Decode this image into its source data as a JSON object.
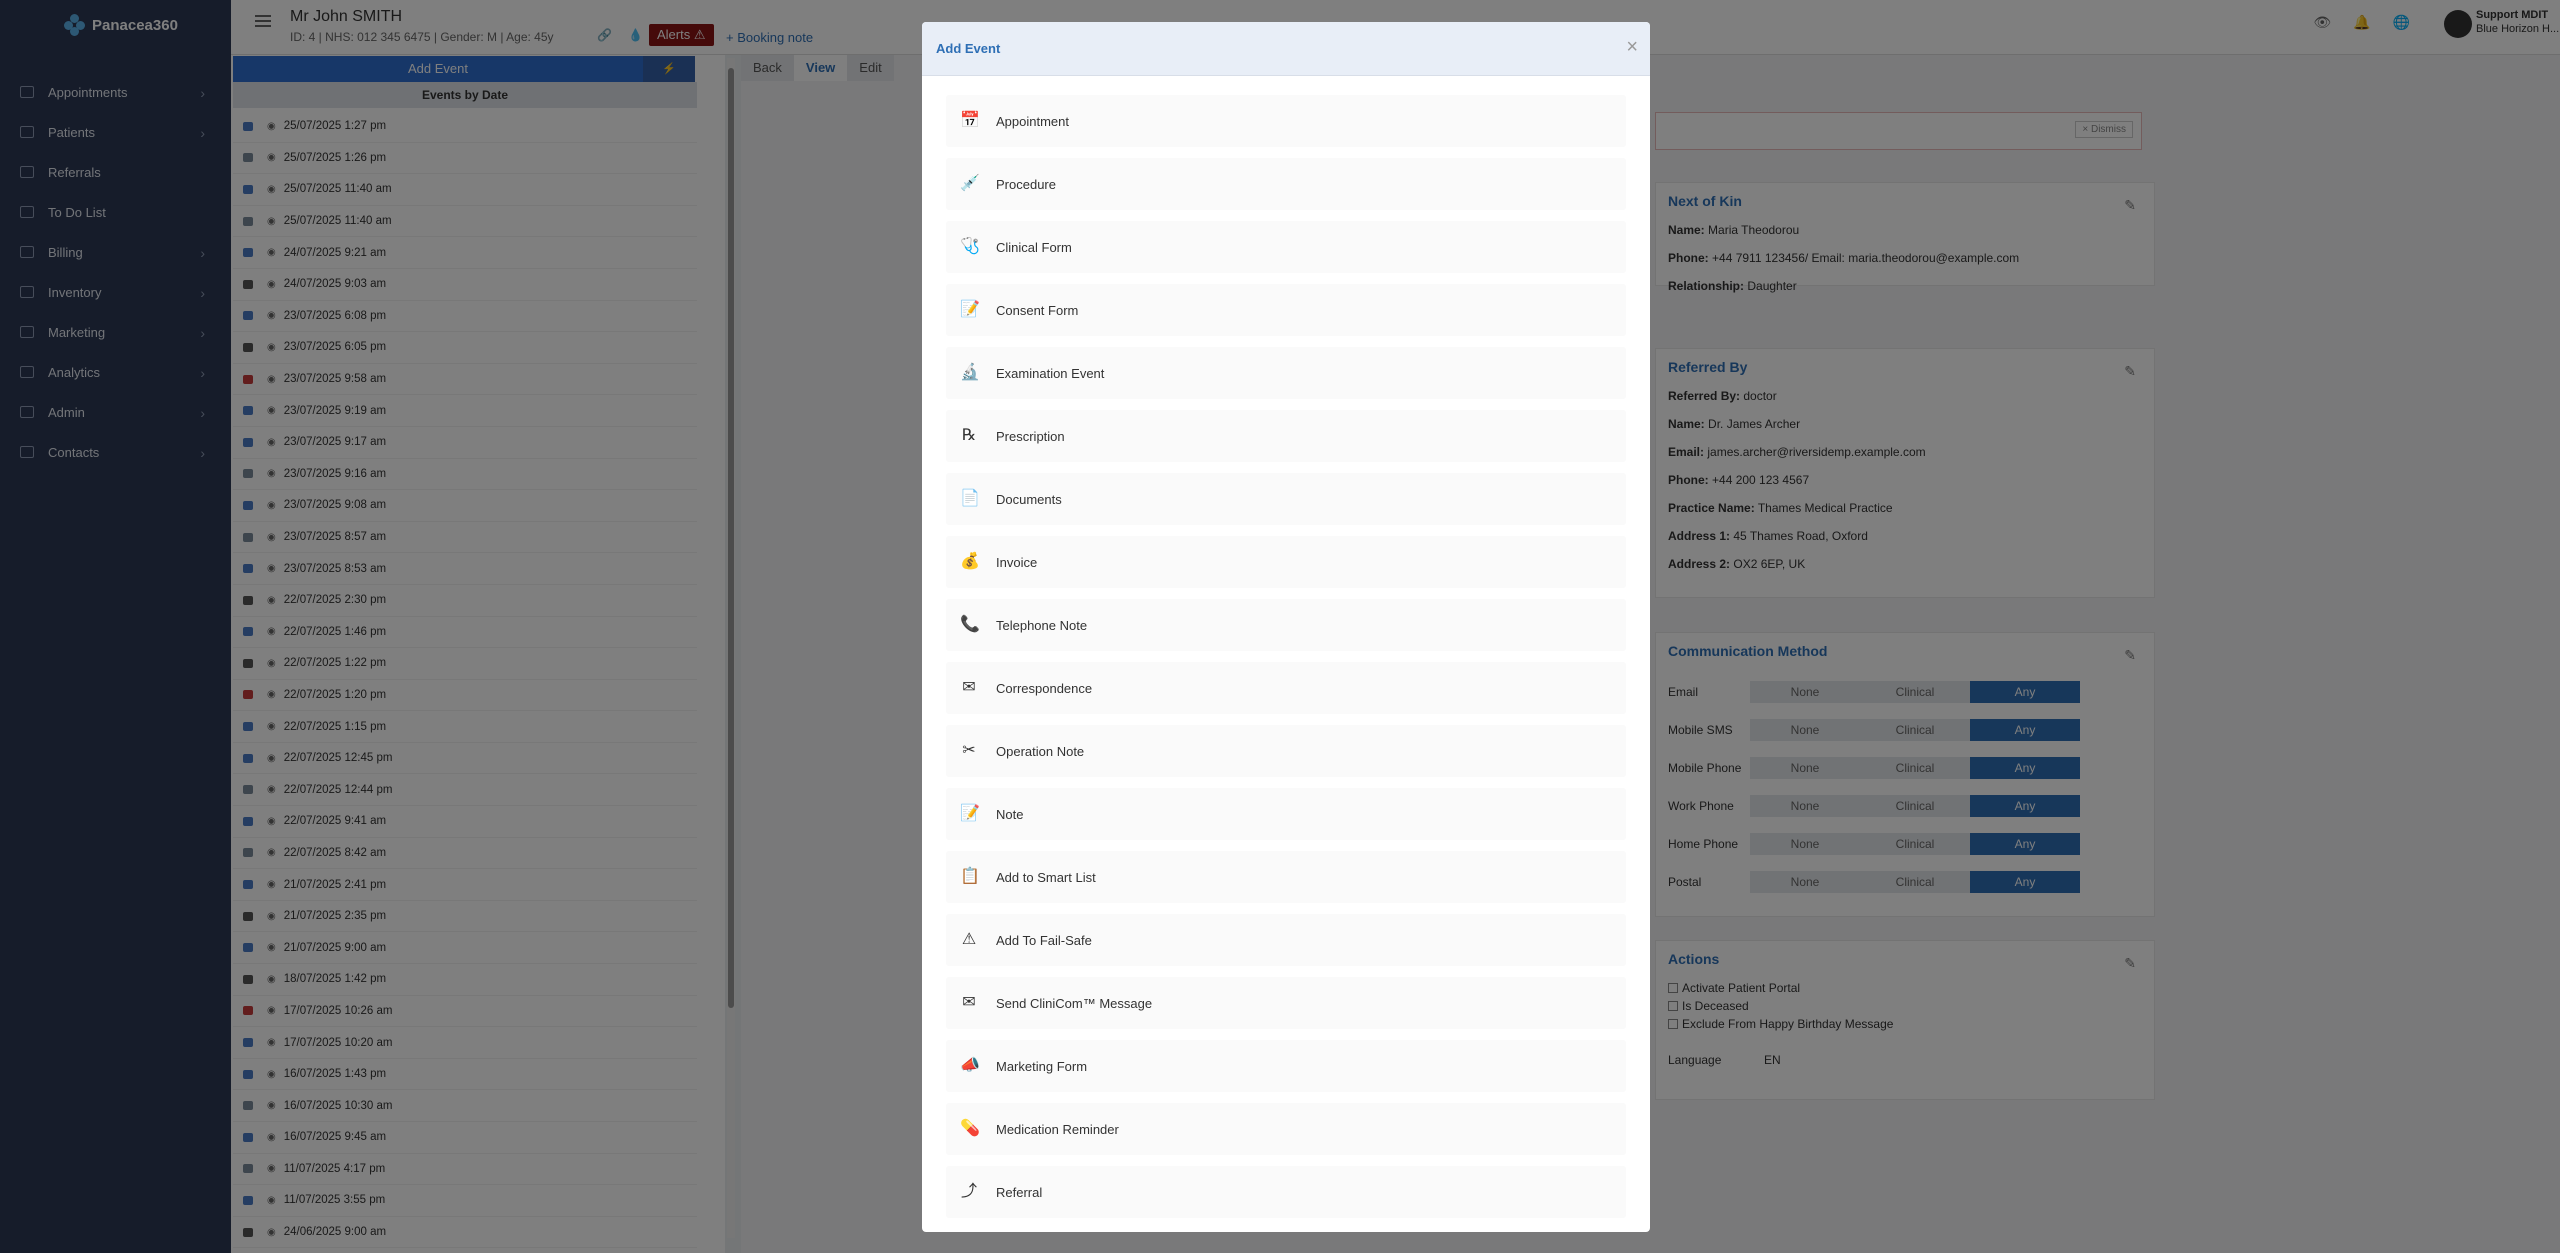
{
  "app": {
    "brand": "Panacea360"
  },
  "sidebar": {
    "items": [
      {
        "label": "Appointments",
        "chev": true
      },
      {
        "label": "Patients",
        "chev": true
      },
      {
        "label": "Referrals",
        "chev": false
      },
      {
        "label": "To Do List",
        "chev": false
      },
      {
        "label": "Billing",
        "chev": true
      },
      {
        "label": "Inventory",
        "chev": true
      },
      {
        "label": "Marketing",
        "chev": true
      },
      {
        "label": "Analytics",
        "chev": true
      },
      {
        "label": "Admin",
        "chev": true
      },
      {
        "label": "Contacts",
        "chev": true
      }
    ]
  },
  "header": {
    "patient_name": "Mr John SMITH",
    "patient_info": "ID: 4 | NHS: 012 345 6475 | Gender: M | Age: 45y",
    "alerts_label": "Alerts ⚠",
    "booking_note": "+ Booking note",
    "user_line1": "Support MDIT",
    "user_line2": "Blue Horizon H..."
  },
  "left_panel": {
    "add_event_label": "Add Event",
    "events_header": "Events by Date",
    "events": [
      "25/07/2025 1:27 pm",
      "25/07/2025 1:26 pm",
      "25/07/2025 11:40 am",
      "25/07/2025 11:40 am",
      "24/07/2025 9:21 am",
      "24/07/2025 9:03 am",
      "23/07/2025 6:08 pm",
      "23/07/2025 6:05 pm",
      "23/07/2025 9:58 am",
      "23/07/2025 9:19 am",
      "23/07/2025 9:17 am",
      "23/07/2025 9:16 am",
      "23/07/2025 9:08 am",
      "23/07/2025 8:57 am",
      "23/07/2025 8:53 am",
      "22/07/2025 2:30 pm",
      "22/07/2025 1:46 pm",
      "22/07/2025 1:22 pm",
      "22/07/2025 1:20 pm",
      "22/07/2025 1:15 pm",
      "22/07/2025 12:45 pm",
      "22/07/2025 12:44 pm",
      "22/07/2025 9:41 am",
      "22/07/2025 8:42 am",
      "21/07/2025 2:41 pm",
      "21/07/2025 2:35 pm",
      "21/07/2025 9:00 am",
      "18/07/2025 1:42 pm",
      "17/07/2025 10:26 am",
      "17/07/2025 10:20 am",
      "16/07/2025 1:43 pm",
      "16/07/2025 10:30 am",
      "16/07/2025 9:45 am",
      "11/07/2025 4:17 pm",
      "11/07/2025 3:55 pm",
      "24/06/2025 9:00 am"
    ]
  },
  "main": {
    "tabs": [
      "Back",
      "View",
      "Edit"
    ],
    "dismiss_label": "× Dismiss",
    "next_of_kin": {
      "title": "Next of Kin",
      "name_label": "Name:",
      "name": "Maria Theodorou",
      "phone_label": "Phone:",
      "phone": "+44 7911 123456/ Email: maria.theodorou@example.com",
      "rel_label": "Relationship:",
      "rel": "Daughter"
    },
    "referred_by": {
      "title": "Referred By",
      "rows": [
        {
          "label": "Referred By:",
          "value": "doctor"
        },
        {
          "label": "Name:",
          "value": "Dr. James Archer"
        },
        {
          "label": "Email:",
          "value": "james.archer@riversidemp.example.com"
        },
        {
          "label": "Phone:",
          "value": "+44 200 123 4567"
        },
        {
          "label": "Practice Name:",
          "value": "Thames Medical Practice"
        },
        {
          "label": "Address 1:",
          "value": "45 Thames Road, Oxford"
        },
        {
          "label": "Address 2:",
          "value": "OX2 6EP, UK"
        }
      ]
    },
    "communication": {
      "title": "Communication Method",
      "options": [
        "None",
        "Clinical",
        "Any"
      ],
      "rows": [
        "Email",
        "Mobile SMS",
        "Mobile Phone",
        "Work Phone",
        "Home Phone",
        "Postal"
      ],
      "selected": "Any"
    },
    "actions": {
      "title": "Actions",
      "checks": [
        "Activate Patient Portal",
        "Is Deceased",
        "Exclude From Happy Birthday Message"
      ],
      "language_label": "Language",
      "language_value": "EN"
    }
  },
  "modal": {
    "title": "Add Event",
    "close": "×",
    "items": [
      {
        "label": "Appointment",
        "icon": "calendar-icon",
        "glyph": "📅"
      },
      {
        "label": "Procedure",
        "icon": "procedure-icon",
        "glyph": "💉"
      },
      {
        "label": "Clinical Form",
        "icon": "stethoscope-icon",
        "glyph": "🩺"
      },
      {
        "label": "Consent Form",
        "icon": "consent-form-icon",
        "glyph": "📝"
      },
      {
        "label": "Examination Event",
        "icon": "microscope-icon",
        "glyph": "🔬"
      },
      {
        "label": "Prescription",
        "icon": "prescription-icon",
        "glyph": "℞"
      },
      {
        "label": "Documents",
        "icon": "document-icon",
        "glyph": "📄"
      },
      {
        "label": "Invoice",
        "icon": "money-bag-icon",
        "glyph": "💰"
      },
      {
        "label": "Telephone Note",
        "icon": "telephone-icon",
        "glyph": "📞"
      },
      {
        "label": "Correspondence",
        "icon": "correspondence-icon",
        "glyph": "✉"
      },
      {
        "label": "Operation Note",
        "icon": "scissors-icon",
        "glyph": "✂"
      },
      {
        "label": "Note",
        "icon": "note-icon",
        "glyph": "📝"
      },
      {
        "label": "Add to Smart List",
        "icon": "clipboard-icon",
        "glyph": "📋"
      },
      {
        "label": "Add To Fail-Safe",
        "icon": "warning-icon",
        "glyph": "⚠"
      },
      {
        "label": "Send CliniCom™ Message",
        "icon": "message-icon",
        "glyph": "✉"
      },
      {
        "label": "Marketing Form",
        "icon": "megaphone-icon",
        "glyph": "📣"
      },
      {
        "label": "Medication Reminder",
        "icon": "pill-icon",
        "glyph": "💊"
      },
      {
        "label": "Referral",
        "icon": "referral-icon",
        "glyph": "⤴"
      }
    ]
  },
  "colors": {
    "accent": "#2e6fb5",
    "sidebar": "#2c3854",
    "alert": "#8a1414"
  }
}
